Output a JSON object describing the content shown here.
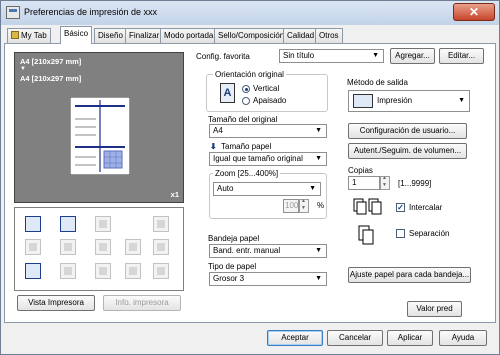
{
  "window": {
    "title": "Preferencias de impresión de xxx",
    "close_glyph": "✕"
  },
  "tabs": [
    {
      "label": "My Tab",
      "icon": "folder-icon"
    },
    {
      "label": "Básico"
    },
    {
      "label": "Diseño"
    },
    {
      "label": "Finalizar"
    },
    {
      "label": "Modo portada"
    },
    {
      "label": "Sello/Composición"
    },
    {
      "label": "Calidad"
    },
    {
      "label": "Otros"
    }
  ],
  "active_tab": "Básico",
  "preview": {
    "line1": "A4 [210x297 mm]",
    "arrow": "▼",
    "line2": "A4 [210x297 mm]",
    "scale": "x1"
  },
  "left_buttons": {
    "view_printer": "Vista Impresora",
    "printer_info": "Info. impresora"
  },
  "favorites": {
    "label": "Config. favorita",
    "value": "Sin título",
    "add": "Agregar...",
    "edit": "Editar..."
  },
  "orientation": {
    "legend": "Orientación original",
    "icon_letter": "A",
    "options": [
      "Vertical",
      "Apaisado"
    ],
    "selected": "Vertical"
  },
  "original_size": {
    "label": "Tamaño del original",
    "value": "A4"
  },
  "paper_size": {
    "label": "Tamaño papel",
    "value": "Igual que tamaño original"
  },
  "zoom": {
    "legend": "Zoom [25...400%]",
    "value": "Auto",
    "percent": "100",
    "unit": "%"
  },
  "paper_tray": {
    "label": "Bandeja papel",
    "value": "Band. entr. manual"
  },
  "paper_type": {
    "label": "Tipo de papel",
    "value": "Grosor 3"
  },
  "output": {
    "label": "Método de salida",
    "value": "Impresión",
    "user_settings": "Configuración de usuario...",
    "auth": "Autent./Seguim. de volumen..."
  },
  "copies": {
    "label": "Copias",
    "value": "1",
    "range": "[1...9999]",
    "collate_label": "Intercalar",
    "collate_checked": true,
    "offset_label": "Separación",
    "offset_checked": false
  },
  "adjust_paper": "Ajuste papel para cada bandeja...",
  "default_btn": "Valor pred",
  "footer": {
    "ok": "Aceptar",
    "cancel": "Cancelar",
    "apply": "Aplicar",
    "help": "Ayuda"
  },
  "colors": {
    "accent_blue": "#1c3f7a",
    "preview_gray": "#808080",
    "title_gradient_top": "#dbe6f4",
    "close_red": "#c7452a"
  }
}
